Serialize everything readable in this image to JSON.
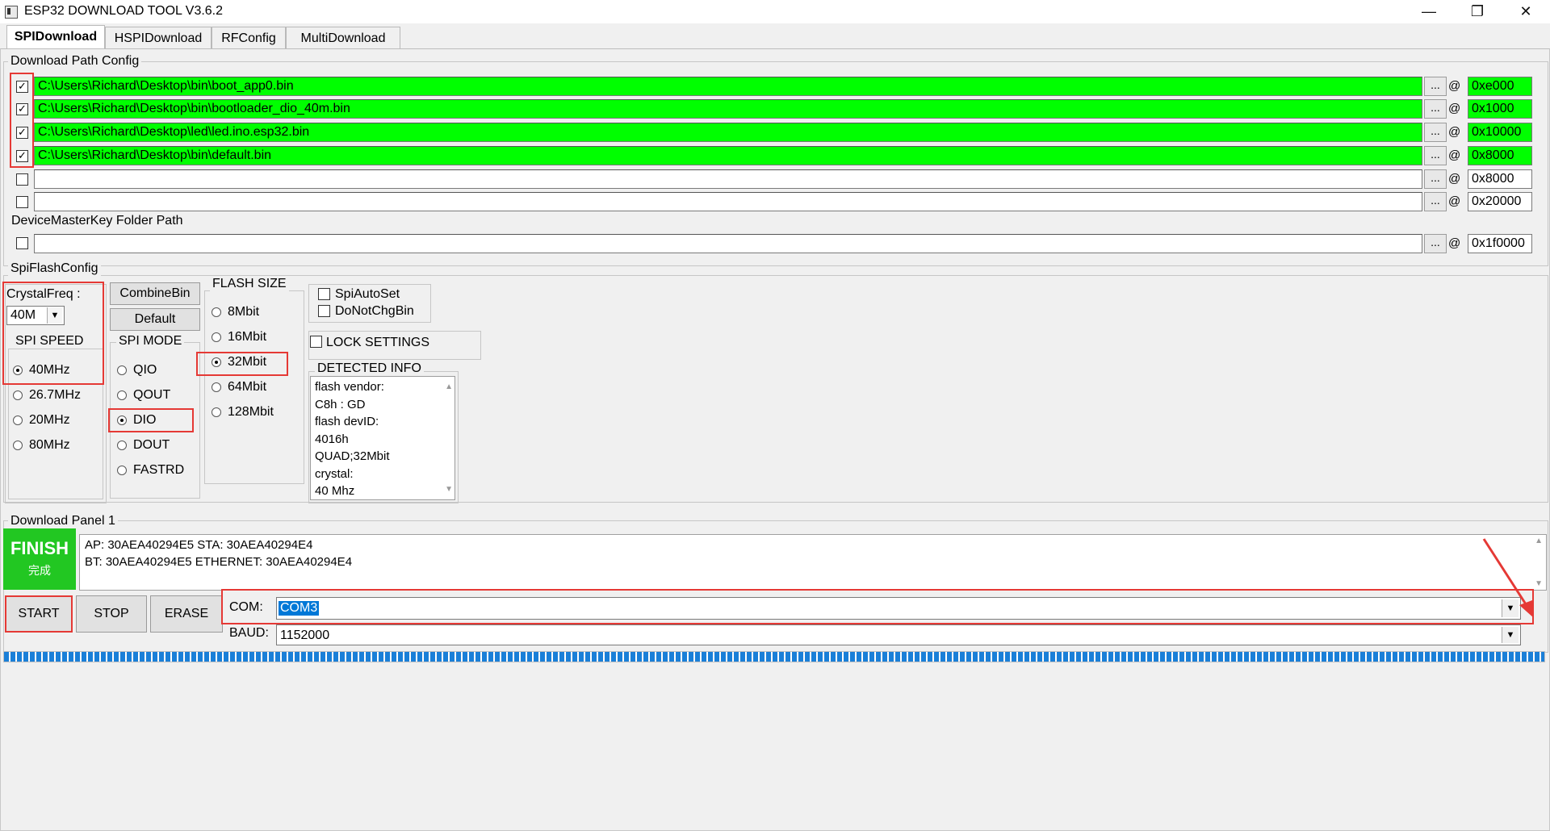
{
  "window": {
    "title": "ESP32 DOWNLOAD TOOL V3.6.2",
    "min_glyph": "—",
    "max_glyph": "❐",
    "close_glyph": "✕"
  },
  "tabs": [
    {
      "label": "SPIDownload",
      "active": true
    },
    {
      "label": "HSPIDownload",
      "active": false
    },
    {
      "label": "RFConfig",
      "active": false
    },
    {
      "label": "MultiDownload",
      "active": false
    }
  ],
  "download_path": {
    "legend": "Download Path Config",
    "rows": [
      {
        "checked": true,
        "path": "C:\\Users\\Richard\\Desktop\\bin\\boot_app0.bin",
        "addr": "0xe000"
      },
      {
        "checked": true,
        "path": "C:\\Users\\Richard\\Desktop\\bin\\bootloader_dio_40m.bin",
        "addr": "0x1000"
      },
      {
        "checked": true,
        "path": "C:\\Users\\Richard\\Desktop\\led\\led.ino.esp32.bin",
        "addr": "0x10000"
      },
      {
        "checked": true,
        "path": "C:\\Users\\Richard\\Desktop\\bin\\default.bin",
        "addr": "0x8000"
      },
      {
        "checked": false,
        "path": "",
        "addr": "0x8000"
      },
      {
        "checked": false,
        "path": "",
        "addr": "0x20000"
      }
    ],
    "browse_label": "...",
    "at_label": "@",
    "check_mark": "✓",
    "master_key_label": "DeviceMasterKey Folder Path",
    "master_key_addr": "0x1f0000"
  },
  "spi_flash": {
    "legend": "SpiFlashConfig",
    "crystal_label": "CrystalFreq :",
    "crystal_value": "40M",
    "dropdown_arrow": "▼",
    "combine_btn": "CombineBin",
    "default_btn": "Default",
    "spi_speed_legend": "SPI SPEED",
    "spi_speed_options": [
      "40MHz",
      "26.7MHz",
      "20MHz",
      "80MHz"
    ],
    "spi_speed_selected": "40MHz",
    "spi_mode_legend": "SPI MODE",
    "spi_mode_options": [
      "QIO",
      "QOUT",
      "DIO",
      "DOUT",
      "FASTRD"
    ],
    "spi_mode_selected": "DIO",
    "flash_size_legend": "FLASH SIZE",
    "flash_size_options": [
      "8Mbit",
      "16Mbit",
      "32Mbit",
      "64Mbit",
      "128Mbit"
    ],
    "flash_size_selected": "32Mbit",
    "spi_auto_set": "SpiAutoSet",
    "do_not_chg_bin": "DoNotChgBin",
    "lock_settings": "LOCK SETTINGS",
    "detected_legend": "DETECTED INFO",
    "detected_lines": [
      "flash vendor:",
      "C8h : GD",
      "flash devID:",
      "4016h",
      "QUAD;32Mbit",
      "crystal:",
      "40 Mhz"
    ]
  },
  "download_panel": {
    "legend": "Download Panel 1",
    "status_en": "FINISH",
    "status_cn": "完成",
    "status_color": "#22c722",
    "log_line1": "AP:  30AEA40294E5  STA:  30AEA40294E4",
    "log_line2": "BT:  30AEA40294E5  ETHERNET:  30AEA40294E4",
    "start_btn": "START",
    "stop_btn": "STOP",
    "erase_btn": "ERASE",
    "com_label": "COM:",
    "com_value": "COM3",
    "baud_label": "BAUD:",
    "baud_value": "1152000",
    "progress_color": "#1a7fd8"
  }
}
